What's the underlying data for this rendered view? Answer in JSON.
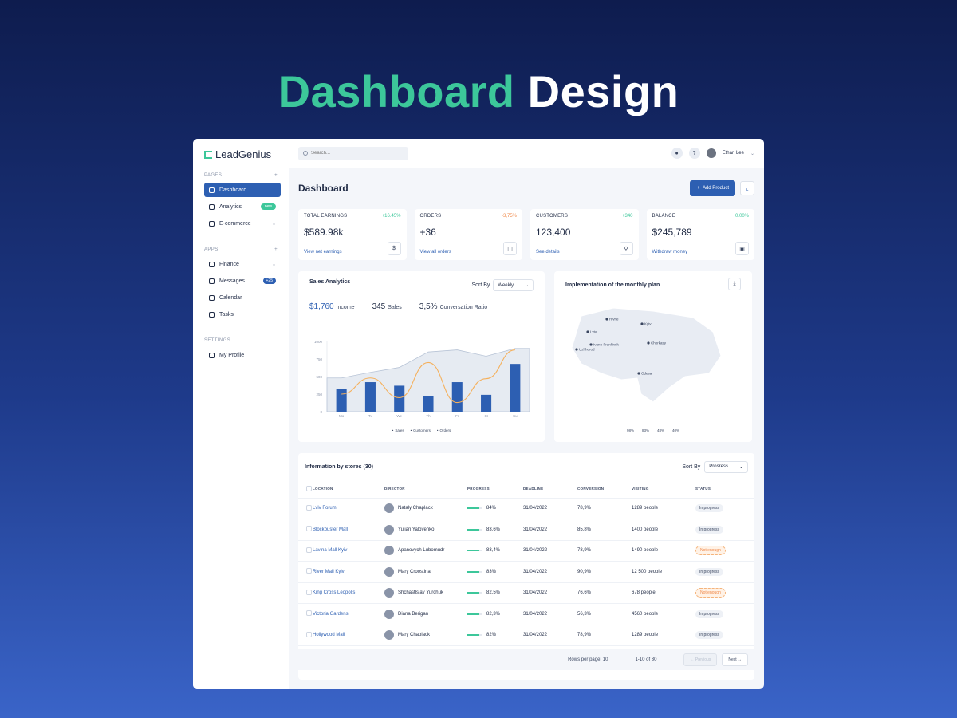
{
  "hero": {
    "word1": "Dashboard",
    "word2": "Design"
  },
  "brand": {
    "name": "LeadGenius"
  },
  "search": {
    "placeholder": "Search..."
  },
  "user": {
    "name": "Ethan Lee"
  },
  "sidebar": {
    "pages_title": "PAGES",
    "pages": [
      {
        "label": "Dashboard",
        "icon": "pie-icon"
      },
      {
        "label": "Analytics",
        "icon": "chart-icon",
        "badge": "new"
      },
      {
        "label": "E-commerce",
        "icon": "cube-icon"
      }
    ],
    "apps_title": "APPS",
    "apps": [
      {
        "label": "Finance",
        "icon": "wallet-icon"
      },
      {
        "label": "Messages",
        "icon": "chat-icon",
        "badge": "+25"
      },
      {
        "label": "Calendar",
        "icon": "calendar-icon"
      },
      {
        "label": "Tasks",
        "icon": "tasks-icon"
      }
    ],
    "settings_title": "SETTINGS",
    "settings": [
      {
        "label": "My Profile",
        "icon": "gear-icon"
      }
    ]
  },
  "main": {
    "title": "Dashboard",
    "add_label": "Add Product"
  },
  "stats": [
    {
      "label": "TOTAL EARNINGS",
      "change": "+16.45%",
      "value": "$589.98k",
      "link": "View net earnings",
      "icon": "dollar-icon"
    },
    {
      "label": "ORDERS",
      "change": "-3,75%",
      "value": "+36",
      "link": "View all orders",
      "icon": "bag-icon"
    },
    {
      "label": "CUSTOMERS",
      "change": "+340",
      "value": "123,400",
      "link": "See details",
      "icon": "user-icon"
    },
    {
      "label": "BALANCE",
      "change": "+0.00%",
      "value": "$245,789",
      "link": "Withdraw money",
      "icon": "wallet-icon"
    }
  ],
  "sales": {
    "title": "Sales Analytics",
    "sort_label": "Sort By",
    "sort_value": "Weekly",
    "kpis": [
      {
        "value": "$1,760",
        "label": "Income"
      },
      {
        "value": "345",
        "label": "Sales"
      },
      {
        "value": "3,5%",
        "label": "Conversation Ratio"
      }
    ]
  },
  "chart_data": {
    "type": "bar",
    "categories": [
      "Mo",
      "Tu",
      "We",
      "Th",
      "Fr",
      "St",
      "Su"
    ],
    "ylim": [
      0,
      1000
    ],
    "yticks": [
      "1000",
      "750",
      "500",
      "250",
      "0"
    ],
    "series": [
      {
        "name": "Sales",
        "type": "bar",
        "values": [
          320,
          420,
          370,
          220,
          420,
          240,
          680
        ]
      },
      {
        "name": "Customers",
        "type": "line",
        "values": [
          250,
          480,
          200,
          700,
          130,
          470,
          880
        ]
      },
      {
        "name": "Orders",
        "type": "area",
        "values": [
          480,
          560,
          630,
          850,
          880,
          790,
          900
        ]
      }
    ],
    "colors": {
      "Sales": "#2d5fb2",
      "Customers": "#f5b05c",
      "Orders": "#b8c4d6"
    }
  },
  "map": {
    "title": "Implementation of the monthly plan",
    "cities": [
      "Rivne",
      "Kyiv",
      "Lviv",
      "Ivano-Frankivsk",
      "Uzhhorod",
      "Cherkasy",
      "Odesa"
    ],
    "legend": [
      "98%",
      "83%",
      "48%",
      "40%"
    ]
  },
  "table": {
    "title": "Information by stores (30)",
    "sort_label": "Sort By",
    "sort_value": "Prosress",
    "headers": [
      "LOCATION",
      "DIRECTOR",
      "PROGRESS",
      "DEADLINE",
      "CONVERSION",
      "VISITING",
      "STATUS"
    ],
    "rows": [
      {
        "location": "Lviv Forum",
        "director": "Nataly Chaplack",
        "progress": "84%",
        "pct": 84,
        "deadline": "31/04/2022",
        "conversion": "78,9%",
        "visiting": "1289 people",
        "status": "In progress",
        "warn": false
      },
      {
        "location": "Blockbuster Mall",
        "director": "Yulian Yalovenko",
        "progress": "83,6%",
        "pct": 83.6,
        "deadline": "31/04/2022",
        "conversion": "85,8%",
        "visiting": "1400 people",
        "status": "In progress",
        "warn": false
      },
      {
        "location": "Lavina Mall Kyiv",
        "director": "Apanovych Lubomudr",
        "progress": "83,4%",
        "pct": 83.4,
        "deadline": "31/04/2022",
        "conversion": "78,9%",
        "visiting": "1490 people",
        "status": "Not enough",
        "warn": true
      },
      {
        "location": "River Mall Kyiv",
        "director": "Mary Croostina",
        "progress": "83%",
        "pct": 83,
        "deadline": "31/04/2022",
        "conversion": "90,9%",
        "visiting": "12 500 people",
        "status": "In progress",
        "warn": false
      },
      {
        "location": "King Cross Leopolis",
        "director": "Shchastlslav Yurchuk",
        "progress": "82,5%",
        "pct": 82.5,
        "deadline": "31/04/2022",
        "conversion": "76,6%",
        "visiting": "678 people",
        "status": "Not enough",
        "warn": true
      },
      {
        "location": "Victoria Gardens",
        "director": "Diana Berigan",
        "progress": "82,3%",
        "pct": 82.3,
        "deadline": "31/04/2022",
        "conversion": "56,3%",
        "visiting": "4560 people",
        "status": "In progress",
        "warn": false
      },
      {
        "location": "Hollywood Mall",
        "director": "Mary Chaplack",
        "progress": "82%",
        "pct": 82,
        "deadline": "31/04/2022",
        "conversion": "78,9%",
        "visiting": "1289 people",
        "status": "In progress",
        "warn": false
      }
    ],
    "rows_per_page": "Rows per page: 10",
    "range": "1-10 of 30",
    "prev": "Previous",
    "next": "Next"
  }
}
